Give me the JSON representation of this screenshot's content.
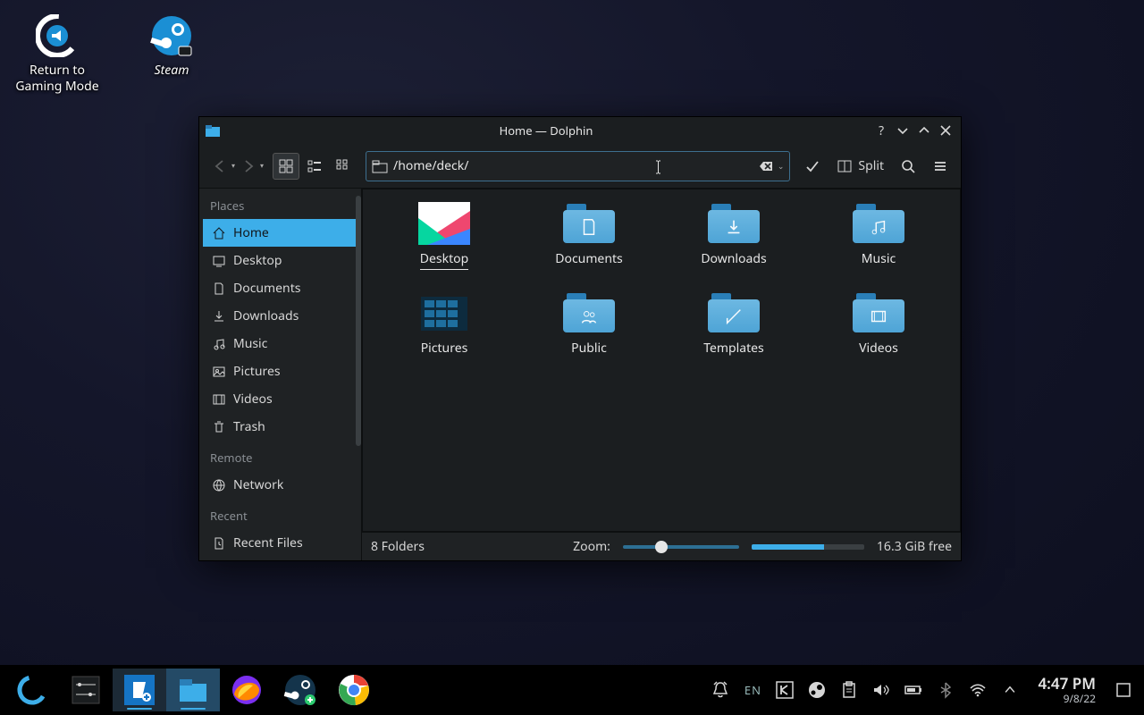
{
  "desktop": {
    "icons": [
      {
        "label": "Return to\nGaming Mode"
      },
      {
        "label": "Steam"
      }
    ]
  },
  "window": {
    "title": "Home — Dolphin",
    "address": "/home/deck/",
    "split_label": "Split"
  },
  "sidebar": {
    "sections": {
      "places": "Places",
      "remote": "Remote",
      "recent": "Recent"
    },
    "places": [
      {
        "label": "Home",
        "selected": true
      },
      {
        "label": "Desktop"
      },
      {
        "label": "Documents"
      },
      {
        "label": "Downloads"
      },
      {
        "label": "Music"
      },
      {
        "label": "Pictures"
      },
      {
        "label": "Videos"
      },
      {
        "label": "Trash"
      }
    ],
    "remote": [
      {
        "label": "Network"
      }
    ],
    "recent": [
      {
        "label": "Recent Files"
      }
    ]
  },
  "folders": [
    {
      "label": "Desktop",
      "kind": "desktop",
      "selected": true
    },
    {
      "label": "Documents",
      "kind": "documents"
    },
    {
      "label": "Downloads",
      "kind": "downloads"
    },
    {
      "label": "Music",
      "kind": "music"
    },
    {
      "label": "Pictures",
      "kind": "pictures"
    },
    {
      "label": "Public",
      "kind": "public"
    },
    {
      "label": "Templates",
      "kind": "templates"
    },
    {
      "label": "Videos",
      "kind": "videos"
    }
  ],
  "status": {
    "count": "8 Folders",
    "zoom_label": "Zoom:",
    "free": "16.3 GiB free"
  },
  "tray": {
    "lang": "EN",
    "time": "4:47 PM",
    "date": "9/8/22"
  }
}
